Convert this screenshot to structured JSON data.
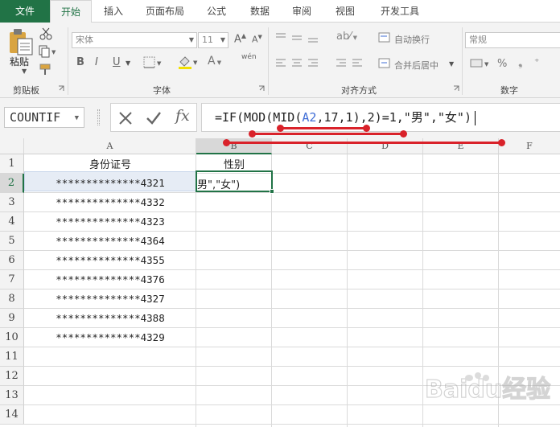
{
  "tabs": [
    "文件",
    "开始",
    "插入",
    "页面布局",
    "公式",
    "数据",
    "审阅",
    "视图",
    "开发工具"
  ],
  "ribbon": {
    "clipboard": {
      "paste": "粘贴",
      "label": "剪贴板"
    },
    "font": {
      "name": "宋体",
      "size": "11",
      "label": "字体",
      "bold": "B",
      "italic": "I",
      "underline": "U",
      "phonetic": "wén"
    },
    "align": {
      "wrap": "自动换行",
      "merge": "合并后居中",
      "label": "对齐方式"
    },
    "number": {
      "format": "常规",
      "label": "数字",
      "percent": "%"
    }
  },
  "formula_bar": {
    "name_box": "COUNTIF",
    "fx": "fx",
    "parts": [
      "=IF(MOD(",
      "MID(",
      "A2",
      ",17,1)",
      ",2)=1,\"男\",\"女\")"
    ]
  },
  "sheet": {
    "columns": [
      "A",
      "B",
      "C",
      "D",
      "E",
      "F"
    ],
    "rows": [
      "1",
      "2",
      "3",
      "4",
      "5",
      "6",
      "7",
      "8",
      "9",
      "10",
      "11",
      "12",
      "13",
      "14"
    ],
    "header_a": "身份证号",
    "header_b": "性别",
    "id_numbers": [
      "**************4321",
      "**************4332",
      "**************4323",
      "**************4364",
      "**************4355",
      "**************4376",
      "**************4327",
      "**************4388",
      "**************4329"
    ],
    "b2_text": "男\",\"女\")"
  },
  "colors": {
    "accent": "#217346",
    "annotation": "#d9222a",
    "reference": "#3f6dd6"
  },
  "watermark": "Baidu经验"
}
